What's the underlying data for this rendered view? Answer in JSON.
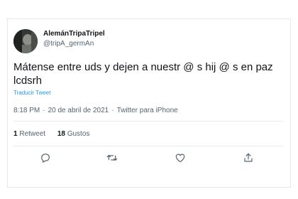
{
  "tweet": {
    "display_name": "AlemánTripaTripel",
    "handle": "@tripA_germAn",
    "text": "Mátense entre uds y dejen a nuestr @ s hij @ s en paz\nlcdsrh",
    "translate_label": "Traducir Tweet",
    "time": "8:18 PM",
    "date": "20 de abril de 2021",
    "separator": "·",
    "source": "Twitter para iPhone"
  },
  "stats": {
    "retweets_count": "1",
    "retweets_label": "Retweet",
    "likes_count": "18",
    "likes_label": "Gustos"
  },
  "actions": [
    "reply-icon",
    "retweet-icon",
    "like-icon",
    "share-icon"
  ],
  "colors": {
    "text": "#0f1419",
    "muted": "#536471",
    "link": "#1d9bf0",
    "border": "#e4e8eb"
  }
}
